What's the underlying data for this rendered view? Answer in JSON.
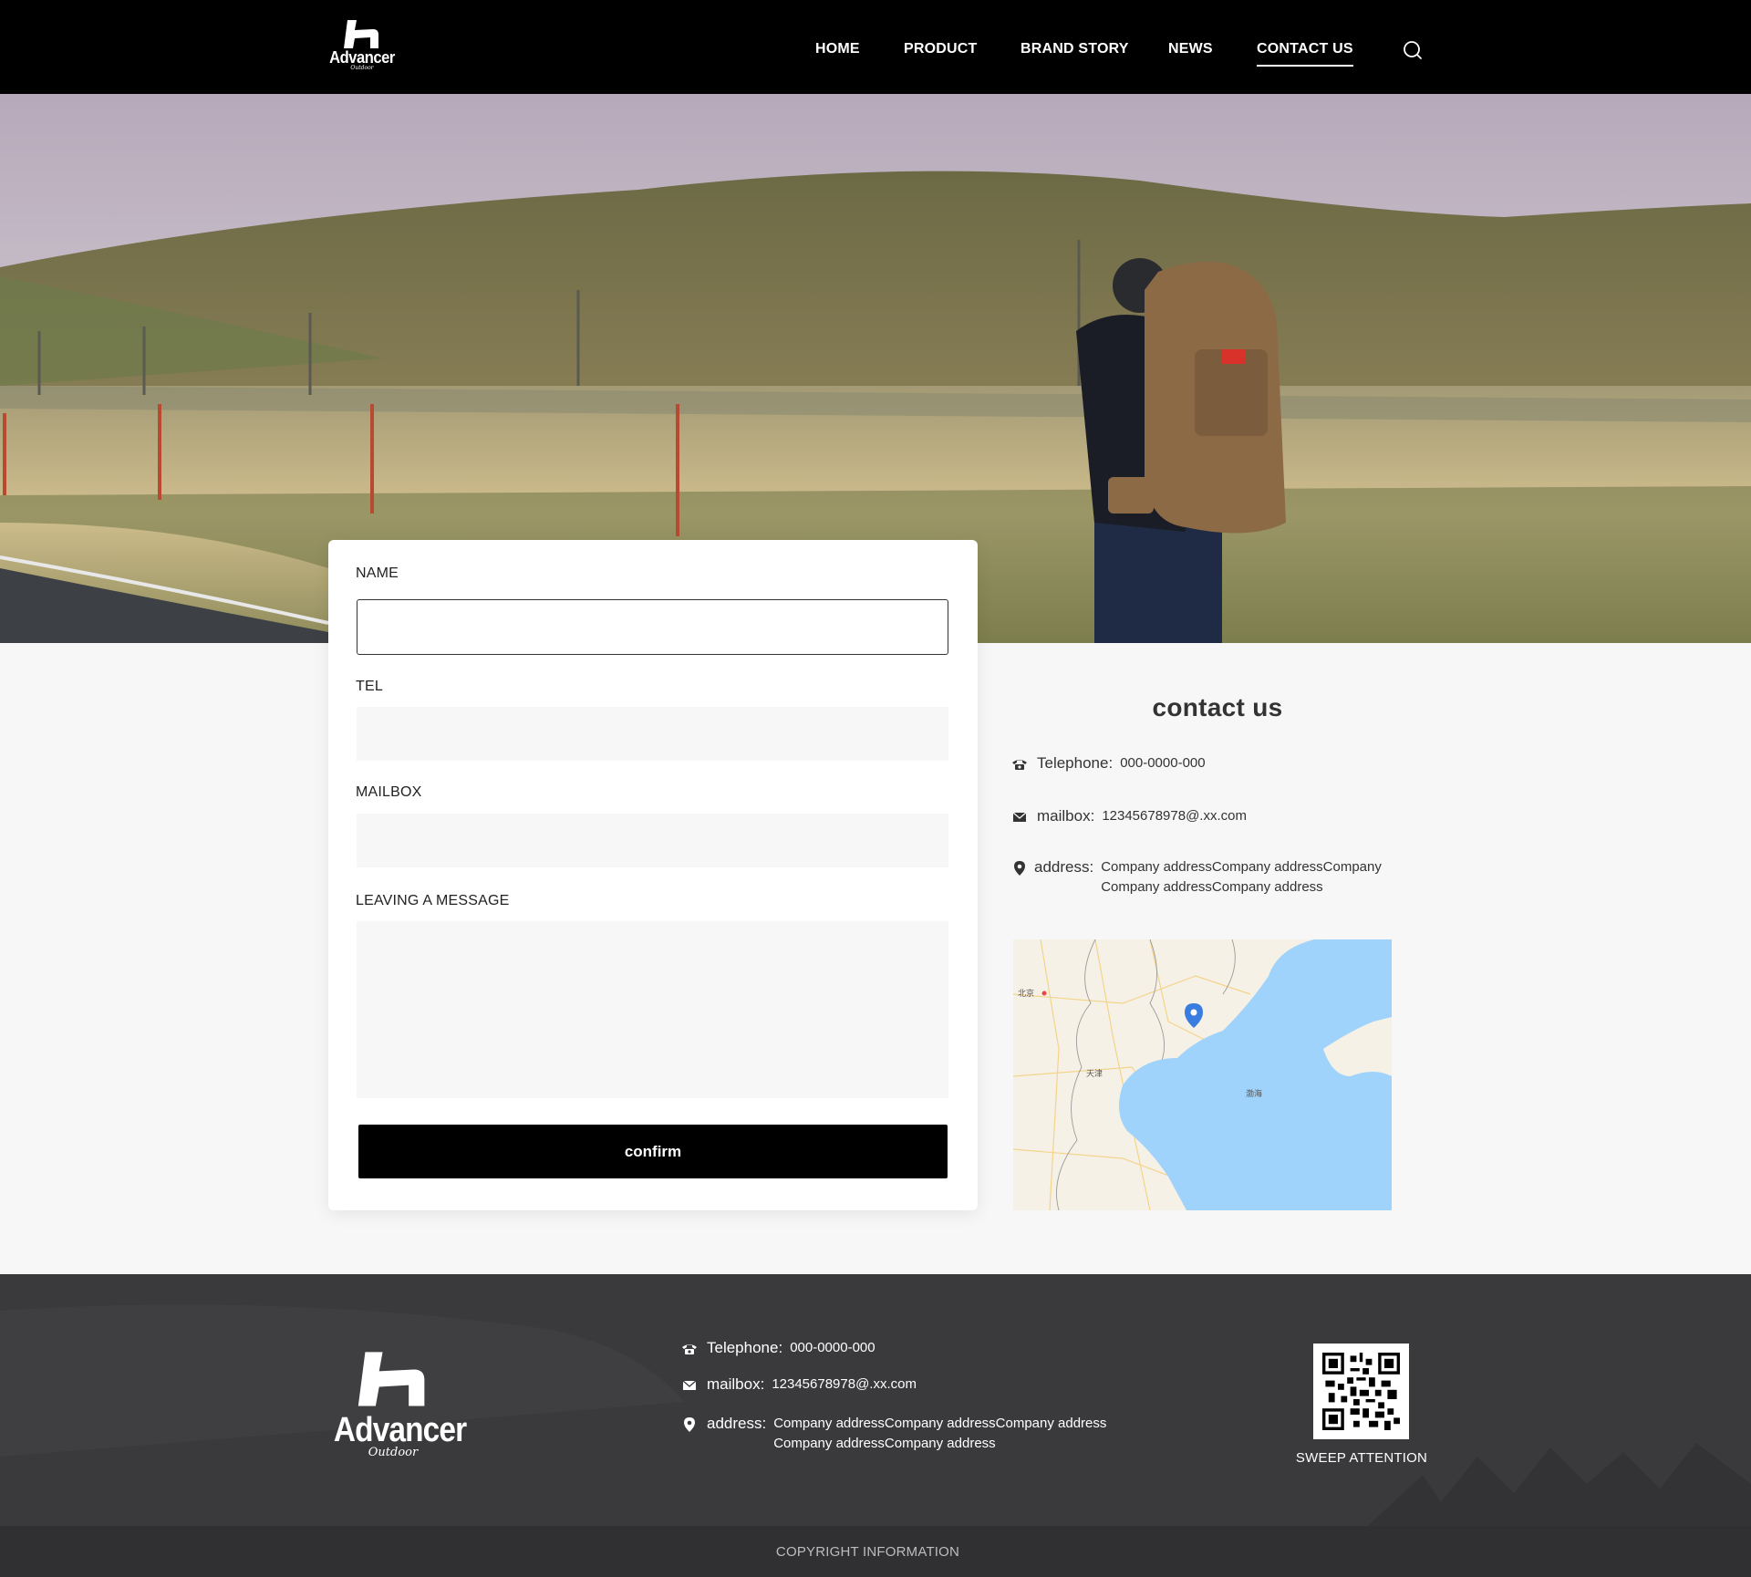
{
  "brand": {
    "logo_word": "Advancer",
    "logo_sub": "Outdoor"
  },
  "nav": {
    "items": [
      {
        "label": "HOME"
      },
      {
        "label": "PRODUCT"
      },
      {
        "label": "BRAND STORY"
      },
      {
        "label": "NEWS"
      },
      {
        "label": "CONTACT US"
      }
    ],
    "active": "CONTACT US",
    "search_icon": "search-icon"
  },
  "form": {
    "name_label": "NAME",
    "name_value": "",
    "tel_label": "TEL",
    "tel_value": "",
    "mailbox_label": "MAILBOX",
    "mailbox_value": "",
    "message_label": "LEAVING A MESSAGE",
    "message_value": "",
    "confirm_label": "confirm"
  },
  "contact": {
    "title": "contact us",
    "telephone_label": "Telephone:",
    "telephone_value": "000-0000-000",
    "mailbox_label": "mailbox:",
    "mailbox_value": "12345678978@.xx.com",
    "address_label": "address:",
    "address_value": "Company addressCompany addressCompany Company addressCompany address",
    "map_labels": [
      "北京",
      "天津",
      "渤海"
    ]
  },
  "footer": {
    "telephone_label": "Telephone:",
    "telephone_value": "000-0000-000",
    "mailbox_label": "mailbox:",
    "mailbox_value": "12345678978@.xx.com",
    "address_label": "address:",
    "address_value": "Company addressCompany addressCompany address Company addressCompany address",
    "qr_caption": "SWEEP ATTENTION",
    "copyright": "COPYRIGHT INFORMATION"
  },
  "colors": {
    "header_bg": "#000000",
    "page_bg": "#f7f7f7",
    "footer_bg": "#3a3a3c",
    "copyright_bg": "#303032",
    "button_bg": "#000000",
    "map_sea": "#9fd3fb",
    "map_pin": "#3a7de0"
  }
}
